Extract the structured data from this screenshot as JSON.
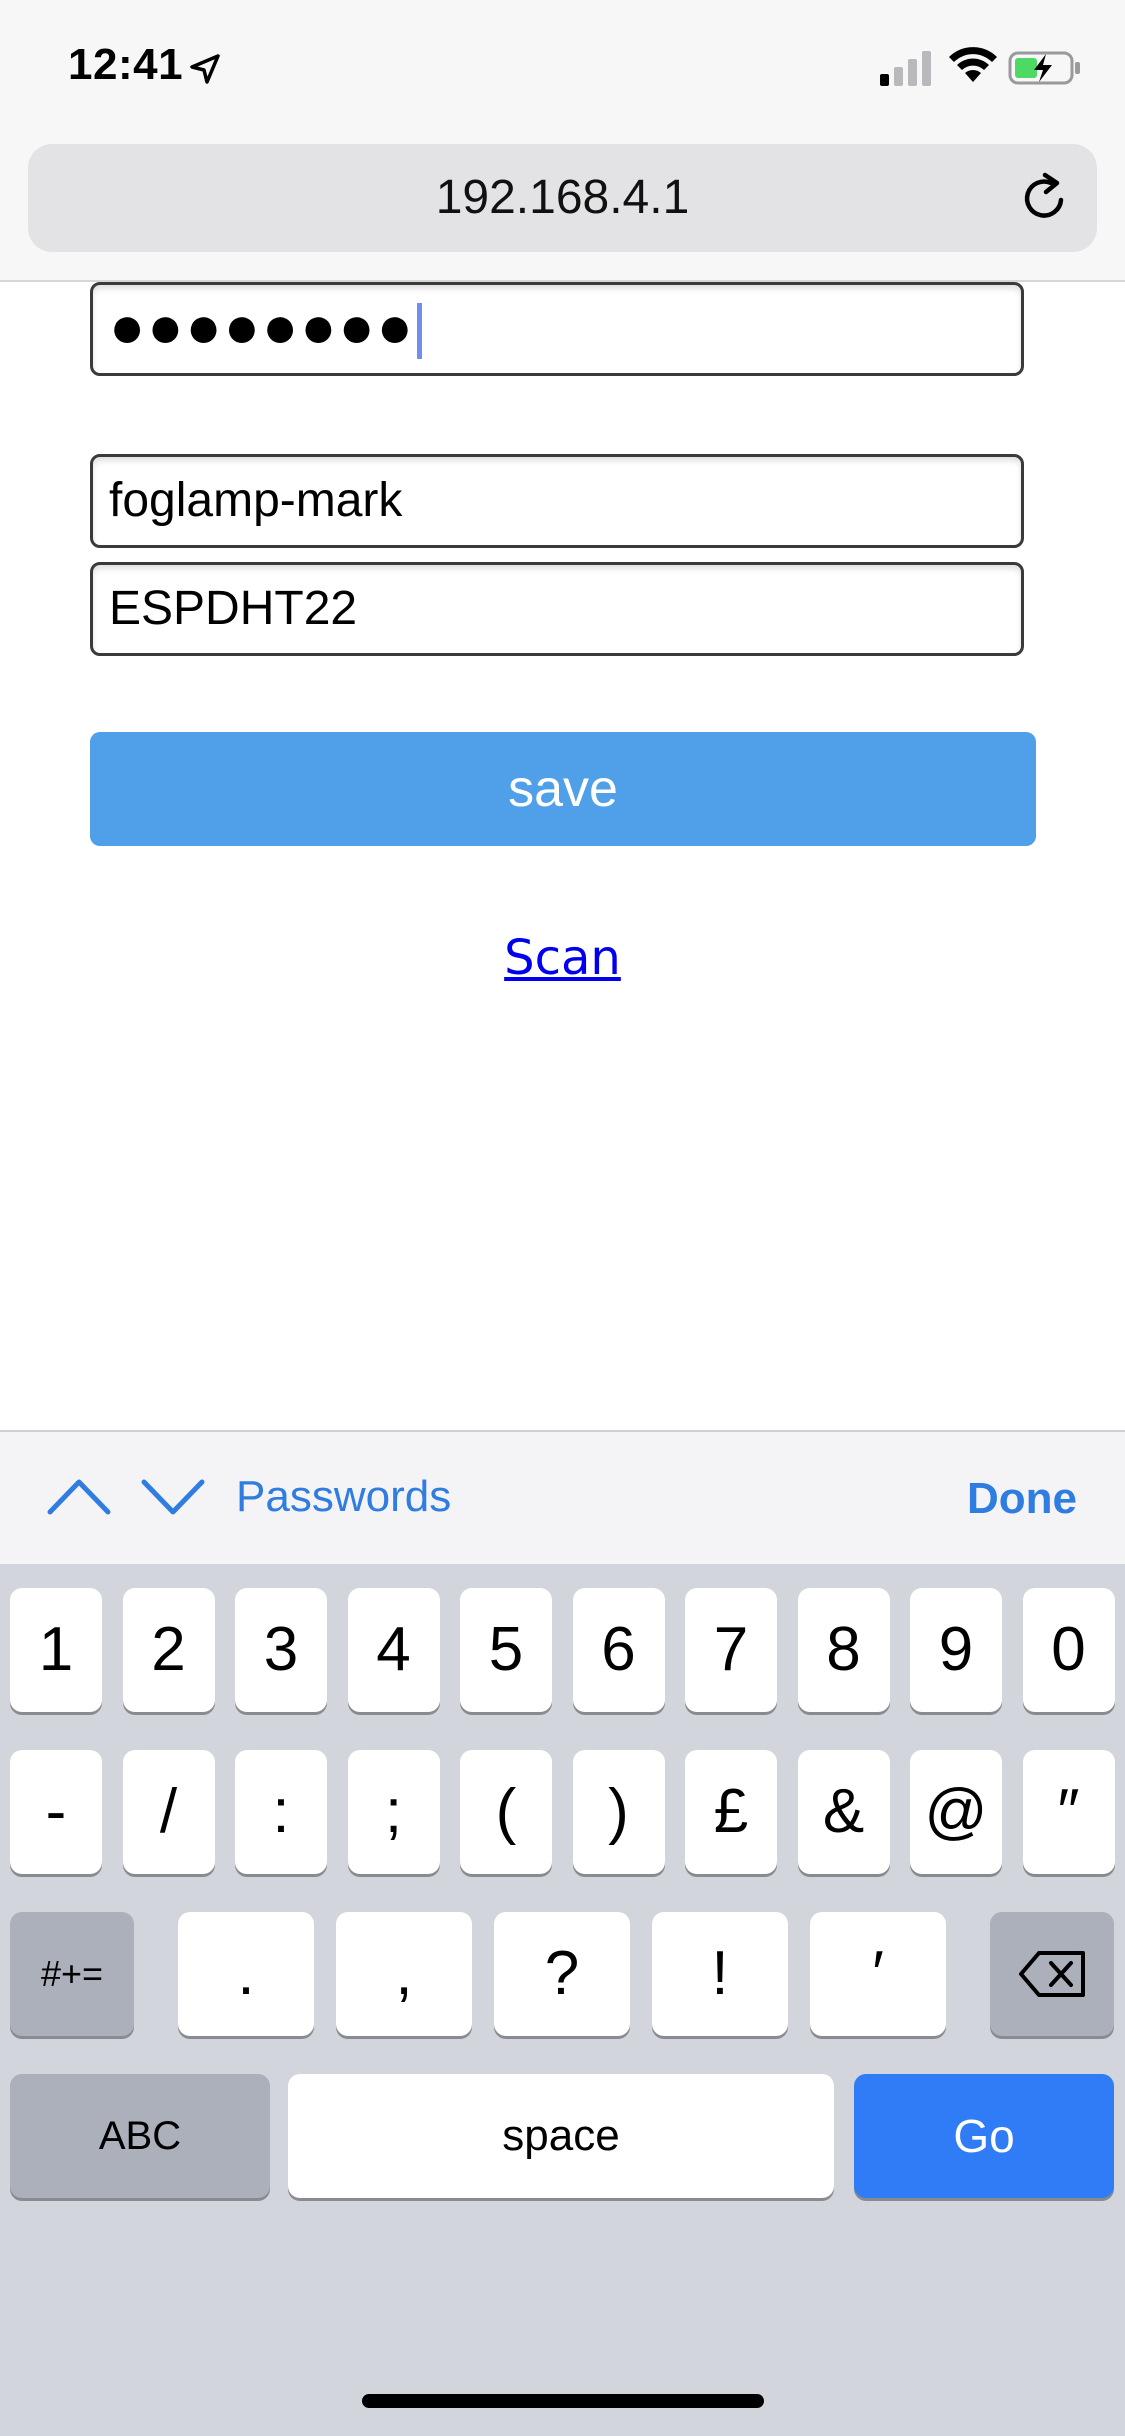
{
  "status_bar": {
    "time": "12:41"
  },
  "url_bar": {
    "url": "192.168.4.1"
  },
  "form": {
    "password_value": "●●●●●●●●",
    "ssid_value": "foglamp-mark",
    "name_value": "ESPDHT22",
    "save_label": "save",
    "scan_label": "Scan"
  },
  "accessory": {
    "passwords_label": "Passwords",
    "done_label": "Done"
  },
  "keyboard": {
    "row1": [
      "1",
      "2",
      "3",
      "4",
      "5",
      "6",
      "7",
      "8",
      "9",
      "0"
    ],
    "row2": [
      "-",
      "/",
      ":",
      ";",
      "(",
      ")",
      "£",
      "&",
      "@",
      "″"
    ],
    "row3_toggle": "#+=",
    "row3": [
      ".",
      ",",
      "?",
      "!",
      "′"
    ],
    "abc_label": "ABC",
    "space_label": "space",
    "go_label": "Go"
  },
  "colors": {
    "accent": "#2f7de1",
    "save_button": "#4fa0e8",
    "go_button": "#2f7cf6",
    "link": "#0000ee"
  },
  "icons": {
    "location": "location-arrow-icon",
    "signal": "cell-signal-icon",
    "wifi": "wifi-icon",
    "battery": "battery-charging-icon",
    "reload": "reload-icon",
    "prev": "chevron-up-icon",
    "next": "chevron-down-icon",
    "delete": "backspace-icon"
  }
}
